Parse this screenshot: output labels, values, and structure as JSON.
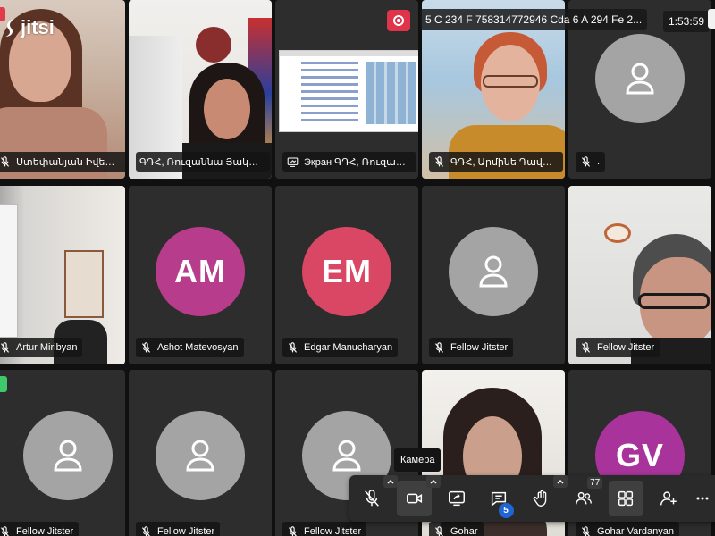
{
  "app": {
    "logo_text": "jitsi"
  },
  "header": {
    "subject": "5 C 234 F 758314772946 Cda 6 A 294 Fe 2...",
    "timer": "1:53:59"
  },
  "colors": {
    "recording": "#e0344a",
    "active_speaker": "#4687ed",
    "badge": "#1f65d6"
  },
  "tiles": [
    {
      "name": "Ստեփանյան Իվետա",
      "icon": "mic-muted-icon",
      "kind": "video"
    },
    {
      "name": "ԳԴՀ, Ռուզաննա Յակոբյան",
      "icon": "none",
      "kind": "video",
      "active": true
    },
    {
      "name": "Экран ԳԴՀ, Ռուզաննա Յ...",
      "icon": "screen-share-icon",
      "kind": "screen"
    },
    {
      "name": "ԳԴՀ, Արմինե Դավթյան",
      "icon": "mic-muted-icon",
      "kind": "video"
    },
    {
      "name": ".",
      "icon": "mic-muted-icon",
      "kind": "avatar"
    },
    {
      "name": "Artur Miribyan",
      "icon": "mic-muted-icon",
      "kind": "video"
    },
    {
      "name": "Ashot Matevosyan",
      "icon": "mic-muted-icon",
      "kind": "avatar",
      "initials": "AM",
      "color": "#b83c8c"
    },
    {
      "name": "Edgar Manucharyan",
      "icon": "mic-muted-icon",
      "kind": "avatar",
      "initials": "EM",
      "color": "#d94764"
    },
    {
      "name": "Fellow Jitster",
      "icon": "mic-muted-icon",
      "kind": "avatar"
    },
    {
      "name": "Fellow Jitster",
      "icon": "mic-muted-icon",
      "kind": "video"
    },
    {
      "name": "Fellow Jitster",
      "icon": "mic-muted-icon",
      "kind": "avatar"
    },
    {
      "name": "Fellow Jitster",
      "icon": "mic-muted-icon",
      "kind": "avatar"
    },
    {
      "name": "Fellow Jitster",
      "icon": "mic-muted-icon",
      "kind": "avatar"
    },
    {
      "name": "Gohar",
      "icon": "mic-muted-icon",
      "kind": "video"
    },
    {
      "name": "Gohar Vardanyan",
      "icon": "mic-muted-icon",
      "kind": "avatar",
      "initials": "GV",
      "color": "#a8339b"
    }
  ],
  "toolbar": {
    "tooltip": "Камера",
    "chat_badge": "5",
    "participants_count": "77",
    "buttons": [
      "mic-muted-icon",
      "camera-icon",
      "share-screen-icon",
      "chat-icon",
      "raise-hand-icon",
      "participants-icon",
      "tile-view-icon",
      "invite-icon",
      "more-icon"
    ]
  }
}
